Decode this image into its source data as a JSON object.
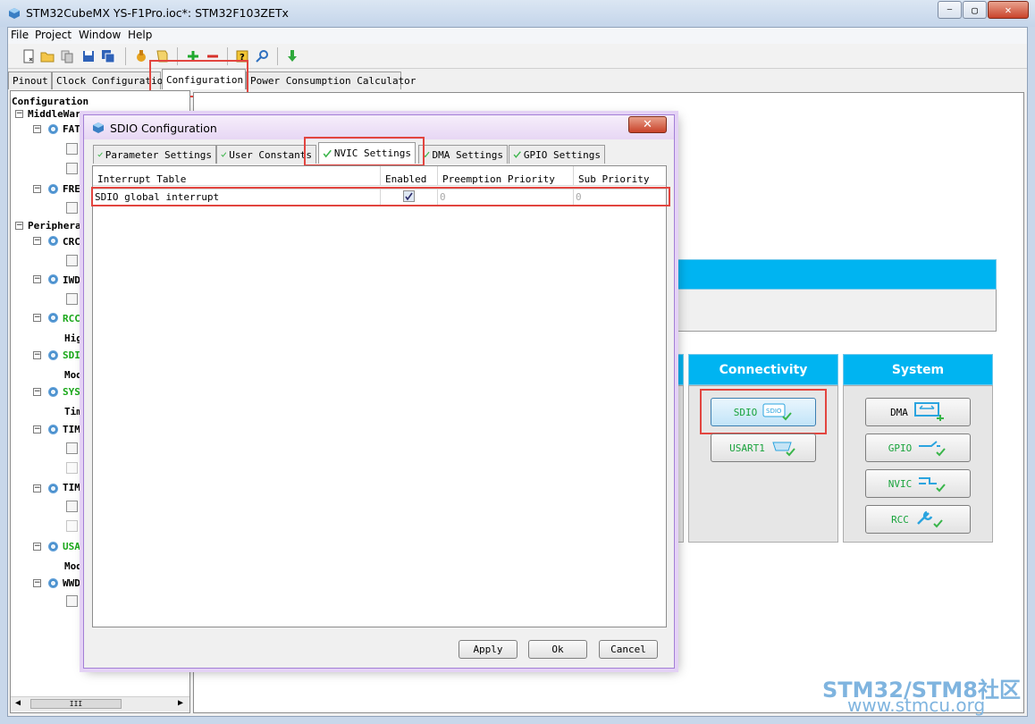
{
  "window": {
    "title": "STM32CubeMX YS-F1Pro.ioc*: STM32F103ZETx",
    "buttons": {
      "minimize": "—",
      "maximize": "▢",
      "close": "✕"
    }
  },
  "menu": [
    "File",
    "Project",
    "Window",
    "Help"
  ],
  "toolbar_icons": [
    "new-project-icon",
    "open-project-icon",
    "copy-icon",
    "save-icon",
    "save-as-icon",
    "generate-code-icon",
    "report-icon",
    "zoom-in-icon",
    "zoom-out-icon",
    "help-icon",
    "search-icon",
    "download-icon"
  ],
  "main_tabs": [
    "Pinout",
    "Clock Configuration",
    "Configuration",
    "Power Consumption Calculator"
  ],
  "active_main_tab": "Configuration",
  "tree": {
    "root": "Configuration",
    "middleware": "MiddleWares",
    "peripherals": "Peripherals",
    "items": [
      {
        "label": "FATFS",
        "shown": "FATI"
      },
      {
        "label": "FREE",
        "shown": "FREI"
      },
      {
        "label": "CRC",
        "shown": "CRC"
      },
      {
        "label": "IWDG",
        "shown": "IWD("
      },
      {
        "label": "RCC",
        "shown": "RCC"
      },
      {
        "label": "High",
        "shown": "Hig"
      },
      {
        "label": "SDIO",
        "shown": "SDI("
      },
      {
        "label": "Mode",
        "shown": "Mod"
      },
      {
        "label": "SYS",
        "shown": "SYS"
      },
      {
        "label": "Time",
        "shown": "Tim"
      },
      {
        "label": "TIM",
        "shown": "TIM("
      },
      {
        "label": "TIM",
        "shown": "TIM"
      },
      {
        "label": "USART",
        "shown": "USA"
      },
      {
        "label": "Mode",
        "shown": "Mod"
      },
      {
        "label": "WWDG",
        "shown": "WWD("
      }
    ],
    "scroll_thumb": "III"
  },
  "categories": {
    "connectivity": "Connectivity",
    "system": "System",
    "connectivity_buttons": [
      "SDIO",
      "USART1"
    ],
    "system_buttons": [
      "DMA",
      "GPIO",
      "NVIC",
      "RCC"
    ]
  },
  "dialog": {
    "title": "SDIO Configuration",
    "close": "✕",
    "tabs": [
      "Parameter Settings",
      "User Constants",
      "NVIC Settings",
      "DMA Settings",
      "GPIO Settings"
    ],
    "active_tab": "NVIC Settings",
    "table": {
      "headers": [
        "Interrupt Table",
        "Enabled",
        "Preemption Priority",
        "Sub Priority"
      ],
      "rows": [
        {
          "name": "SDIO global interrupt",
          "enabled": true,
          "preemption": "0",
          "sub": "0"
        }
      ]
    },
    "buttons": {
      "apply": "Apply",
      "ok": "Ok",
      "cancel": "Cancel"
    }
  },
  "watermark": {
    "line1": "STM32/STM8社区",
    "line2": "www.stmcu.org"
  },
  "colors": {
    "accent_blue": "#00b4f1",
    "highlight_red": "#e2453f",
    "enabled_green": "#1aa81a"
  }
}
